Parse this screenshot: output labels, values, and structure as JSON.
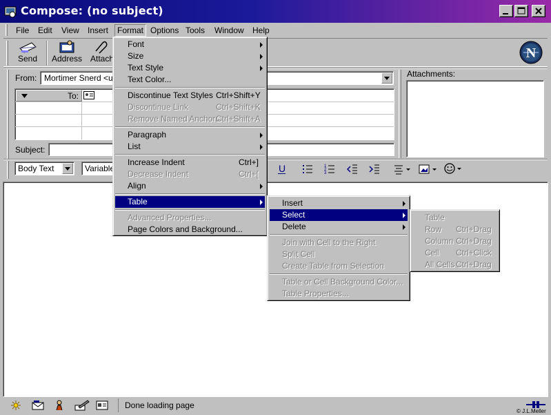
{
  "window": {
    "title": "Compose: (no subject)"
  },
  "menubar": [
    "File",
    "Edit",
    "View",
    "Insert",
    "Format",
    "Options",
    "Tools",
    "Window",
    "Help"
  ],
  "toolbar": {
    "send": "Send",
    "address": "Address",
    "attach": "Attach"
  },
  "header": {
    "from_label": "From:",
    "from_value": "Mortimer Snerd <use",
    "to_label": "To:",
    "subject_label": "Subject:",
    "attachments_label": "Attachments:"
  },
  "format_bar": {
    "style": "Body Text",
    "font": "Variable"
  },
  "format_menu": {
    "items": [
      {
        "label": "Font",
        "submenu": true
      },
      {
        "label": "Size",
        "submenu": true
      },
      {
        "label": "Text Style",
        "submenu": true
      },
      {
        "label": "Text Color..."
      },
      {
        "label": "Discontinue Text Styles",
        "shortcut": "Ctrl+Shift+Y"
      },
      {
        "label": "Discontinue Link",
        "shortcut": "Ctrl+Shift+K",
        "disabled": true
      },
      {
        "label": "Remove Named Anchors",
        "shortcut": "Ctrl+Shift+A",
        "disabled": true
      },
      {
        "label": "Paragraph",
        "submenu": true
      },
      {
        "label": "List",
        "submenu": true
      },
      {
        "label": "Increase Indent",
        "shortcut": "Ctrl+]"
      },
      {
        "label": "Decrease Indent",
        "shortcut": "Ctrl+[",
        "disabled": true
      },
      {
        "label": "Align",
        "submenu": true
      },
      {
        "label": "Table",
        "submenu": true,
        "highlighted": true
      },
      {
        "label": "Advanced Properties...",
        "disabled": true
      },
      {
        "label": "Page Colors and Background..."
      }
    ]
  },
  "table_menu": {
    "items": [
      {
        "label": "Insert",
        "submenu": true
      },
      {
        "label": "Select",
        "submenu": true,
        "highlighted": true
      },
      {
        "label": "Delete",
        "submenu": true
      },
      {
        "label": "Join with Cell to the Right",
        "disabled": true
      },
      {
        "label": "Split Cell",
        "disabled": true
      },
      {
        "label": "Create Table from Selection",
        "disabled": true
      },
      {
        "label": "Table or Cell Background Color...",
        "disabled": true
      },
      {
        "label": "Table Properties...",
        "disabled": true
      }
    ]
  },
  "select_menu": {
    "items": [
      {
        "label": "Table",
        "disabled": true
      },
      {
        "label": "Row",
        "shortcut": "Ctrl+Drag",
        "disabled": true
      },
      {
        "label": "Column",
        "shortcut": "Ctrl+Drag",
        "disabled": true
      },
      {
        "label": "Cell",
        "shortcut": "Ctrl+Click",
        "disabled": true
      },
      {
        "label": "All Cells",
        "shortcut": "Ctrl+Drag",
        "disabled": true
      }
    ]
  },
  "status": {
    "text": "Done loading page",
    "credit": "© J.L.Meller"
  },
  "colors": {
    "titlebar_start": "#0a0a7a",
    "titlebar_end": "#9a2aa8",
    "highlight": "#000080",
    "chrome": "#c0c0c0"
  }
}
